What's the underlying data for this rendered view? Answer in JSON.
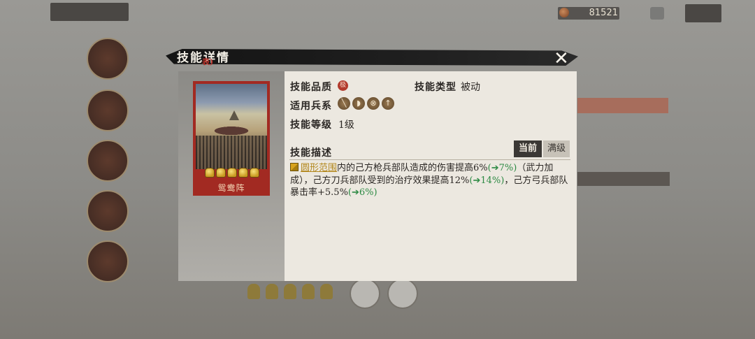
{
  "currency": {
    "icon": "copper-coin-icon",
    "amount": "81521"
  },
  "dialog": {
    "title": "技能详情",
    "title_red": "表)",
    "close_label": "✕"
  },
  "card": {
    "name": "鸳鸯阵",
    "stars": 5,
    "border_color": "#a22a22"
  },
  "info": {
    "quality_label": "技能品质",
    "quality_badge": "极",
    "type_label": "技能类型",
    "type_value": "被动",
    "troops_label": "适用兵系",
    "troops": [
      {
        "icon": "spear-icon",
        "glyph": "╲"
      },
      {
        "icon": "shield-icon",
        "glyph": "◗"
      },
      {
        "icon": "bow-icon",
        "glyph": "⊗"
      },
      {
        "icon": "cavalry-icon",
        "glyph": "↑"
      }
    ],
    "level_label": "技能等级",
    "level_value": "1级",
    "desc_label": "技能描述"
  },
  "tabs": {
    "current": "当前",
    "max": "满级"
  },
  "description": {
    "range_text": "圆形范围",
    "part1": "内的己方枪兵部队造成的伤害提高6%",
    "up1": "(➔7%)",
    "part2": "（武力加成），己方刀兵部队受到的治疗效果提高12%",
    "up2": "(➔14%)",
    "part3": "，己方弓兵部队暴击率+5.5%",
    "up3": "(➔6%)"
  },
  "colors": {
    "accent_red": "#b23a2c",
    "upgrade_green": "#2d8a44",
    "range_gold": "#b2861a"
  }
}
